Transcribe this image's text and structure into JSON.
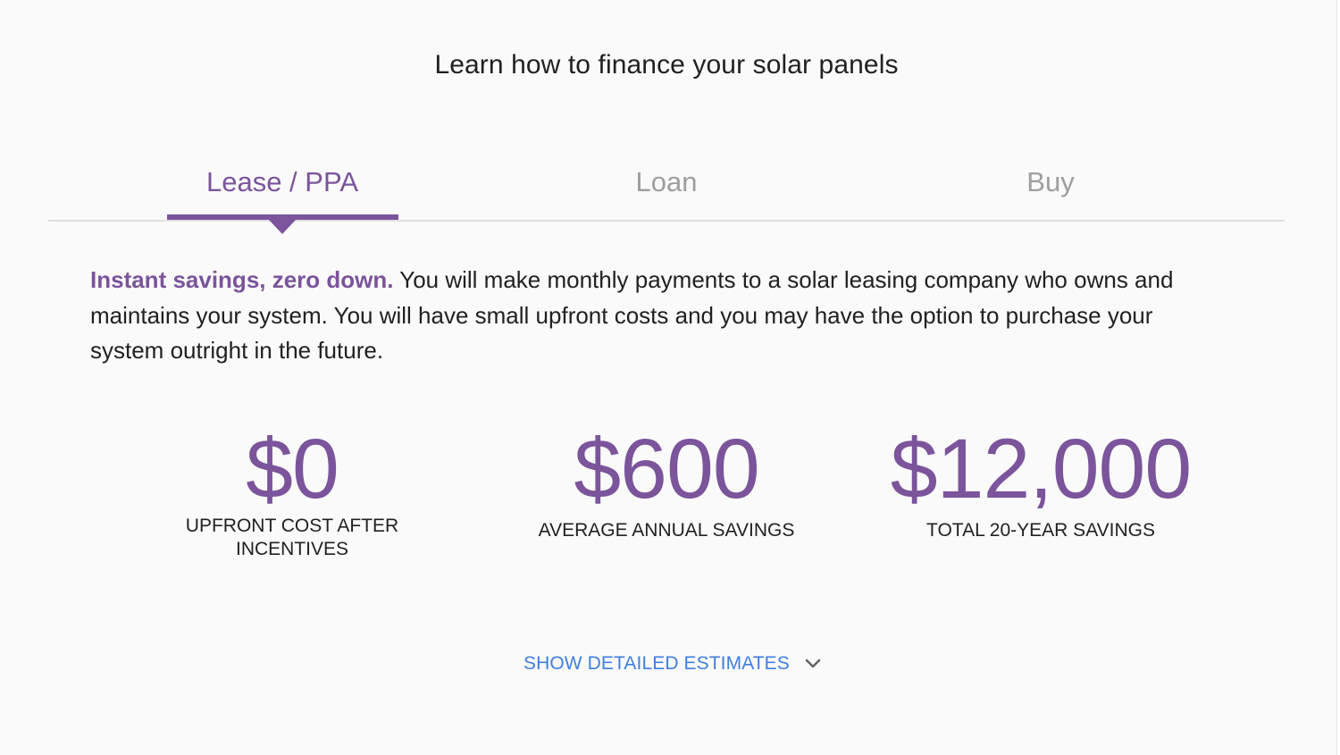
{
  "page": {
    "title": "Learn how to finance your solar panels"
  },
  "tabs": [
    {
      "label": "Lease / PPA",
      "active": true
    },
    {
      "label": "Loan",
      "active": false
    },
    {
      "label": "Buy",
      "active": false
    }
  ],
  "description": {
    "lead": "Instant savings, zero down.",
    "body": " You will make monthly payments to a solar leasing company who owns and maintains your system. You will have small upfront costs and you may have the option to purchase your system outright in the future."
  },
  "stats": [
    {
      "value": "$0",
      "label": "UPFRONT COST AFTER INCENTIVES"
    },
    {
      "value": "$600",
      "label": "AVERAGE ANNUAL SAVINGS"
    },
    {
      "value": "$12,000",
      "label": "TOTAL 20-YEAR SAVINGS"
    }
  ],
  "actions": {
    "show_details_label": "SHOW DETAILED ESTIMATES",
    "show_details_icon": "chevron-down-icon"
  },
  "colors": {
    "accent": "#7b549b",
    "link": "#3f7fe0",
    "text": "#212121",
    "inactive_tab": "#9e9e9e"
  }
}
